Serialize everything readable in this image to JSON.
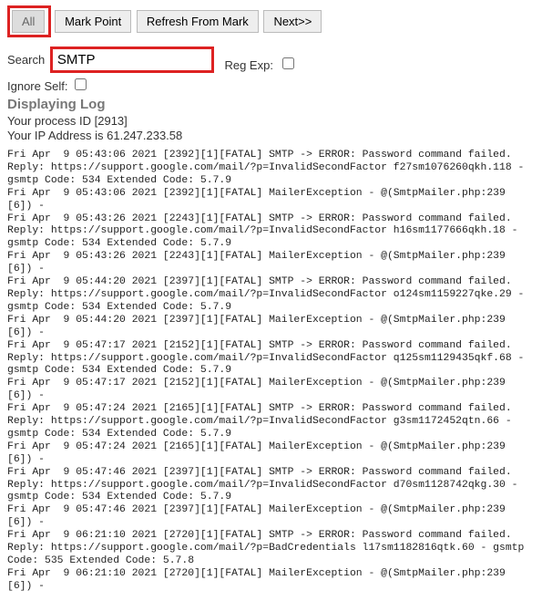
{
  "toolbar": {
    "all": "All",
    "mark": "Mark Point",
    "refresh": "Refresh From Mark",
    "next": "Next>>"
  },
  "filters": {
    "search_label": "Search",
    "search_value": "SMTP",
    "regexp_label": "Reg Exp:",
    "ignore_label": "Ignore Self:"
  },
  "heading": "Displaying Log",
  "info": {
    "process": "Your process ID [2913]",
    "ip": "Your IP Address is 61.247.233.58"
  },
  "log_entries": [
    "Fri Apr  9 05:43:06 2021 [2392][1][FATAL] SMTP -> ERROR: Password command failed. Reply: https://support.google.com/mail/?p=InvalidSecondFactor f27sm1076260qkh.118 - gsmtp Code: 534 Extended Code: 5.7.9",
    "Fri Apr  9 05:43:06 2021 [2392][1][FATAL] MailerException - @(SmtpMailer.php:239 [6]) -",
    "Fri Apr  9 05:43:26 2021 [2243][1][FATAL] SMTP -> ERROR: Password command failed. Reply: https://support.google.com/mail/?p=InvalidSecondFactor h16sm1177666qkh.18 - gsmtp Code: 534 Extended Code: 5.7.9",
    "Fri Apr  9 05:43:26 2021 [2243][1][FATAL] MailerException - @(SmtpMailer.php:239 [6]) -",
    "Fri Apr  9 05:44:20 2021 [2397][1][FATAL] SMTP -> ERROR: Password command failed. Reply: https://support.google.com/mail/?p=InvalidSecondFactor o124sm1159227qke.29 - gsmtp Code: 534 Extended Code: 5.7.9",
    "Fri Apr  9 05:44:20 2021 [2397][1][FATAL] MailerException - @(SmtpMailer.php:239 [6]) -",
    "Fri Apr  9 05:47:17 2021 [2152][1][FATAL] SMTP -> ERROR: Password command failed. Reply: https://support.google.com/mail/?p=InvalidSecondFactor q125sm1129435qkf.68 - gsmtp Code: 534 Extended Code: 5.7.9",
    "Fri Apr  9 05:47:17 2021 [2152][1][FATAL] MailerException - @(SmtpMailer.php:239 [6]) -",
    "Fri Apr  9 05:47:24 2021 [2165][1][FATAL] SMTP -> ERROR: Password command failed. Reply: https://support.google.com/mail/?p=InvalidSecondFactor g3sm1172452qtn.66 - gsmtp Code: 534 Extended Code: 5.7.9",
    "Fri Apr  9 05:47:24 2021 [2165][1][FATAL] MailerException - @(SmtpMailer.php:239 [6]) -",
    "Fri Apr  9 05:47:46 2021 [2397][1][FATAL] SMTP -> ERROR: Password command failed. Reply: https://support.google.com/mail/?p=InvalidSecondFactor d70sm1128742qkg.30 - gsmtp Code: 534 Extended Code: 5.7.9",
    "Fri Apr  9 05:47:46 2021 [2397][1][FATAL] MailerException - @(SmtpMailer.php:239 [6]) -",
    "Fri Apr  9 06:21:10 2021 [2720][1][FATAL] SMTP -> ERROR: Password command failed. Reply: https://support.google.com/mail/?p=BadCredentials l17sm1182816qtk.60 - gsmtp Code: 535 Extended Code: 5.7.8",
    "Fri Apr  9 06:21:10 2021 [2720][1][FATAL] MailerException - @(SmtpMailer.php:239 [6]) -"
  ]
}
